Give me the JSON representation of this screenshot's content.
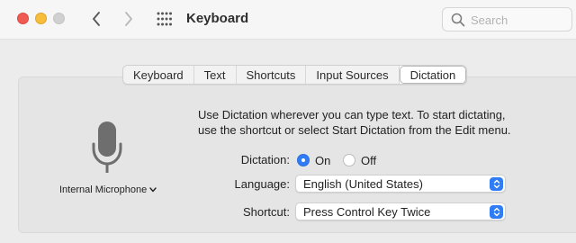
{
  "window": {
    "title": "Keyboard",
    "search_placeholder": "Search"
  },
  "tabs": [
    {
      "label": "Keyboard",
      "active": false
    },
    {
      "label": "Text",
      "active": false
    },
    {
      "label": "Shortcuts",
      "active": false
    },
    {
      "label": "Input Sources",
      "active": false
    },
    {
      "label": "Dictation",
      "active": true
    }
  ],
  "dictation": {
    "description_line1": "Use Dictation wherever you can type text. To start dictating,",
    "description_line2": "use the shortcut or select Start Dictation from the Edit menu.",
    "microphone_label": "Internal Microphone",
    "dictation_label": "Dictation:",
    "on_label": "On",
    "off_label": "Off",
    "dictation_value": "On",
    "language_label": "Language:",
    "language_value": "English (United States)",
    "shortcut_label": "Shortcut:",
    "shortcut_value": "Press Control Key Twice"
  },
  "colors": {
    "accent": "#2f7cf6",
    "close": "#ef5b52",
    "minimize": "#f7bd3b",
    "zoom_disabled": "#d0d0d0"
  },
  "icons": {
    "back": "chevron-left-icon",
    "forward": "chevron-right-icon",
    "grid": "grid-icon",
    "search": "magnifying-glass-icon",
    "microphone": "microphone-icon"
  }
}
